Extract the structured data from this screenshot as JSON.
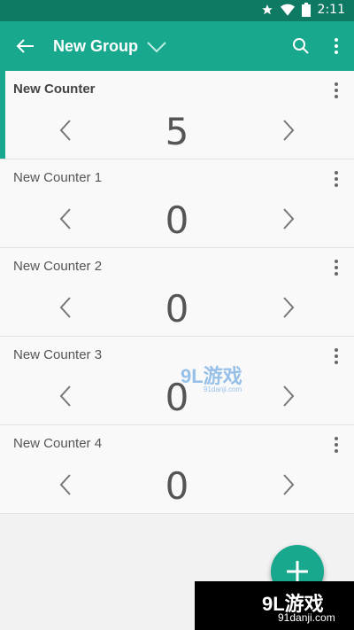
{
  "status_bar": {
    "time": "2:11"
  },
  "app_bar": {
    "title": "New Group"
  },
  "counters": [
    {
      "name": "New Counter",
      "value": "5",
      "active": true
    },
    {
      "name": "New Counter 1",
      "value": "0",
      "active": false
    },
    {
      "name": "New Counter 2",
      "value": "0",
      "active": false
    },
    {
      "name": "New Counter 3",
      "value": "0",
      "active": false
    },
    {
      "name": "New Counter 4",
      "value": "0",
      "active": false
    }
  ],
  "watermark": {
    "logo": "9L游戏",
    "site": "91danji.com",
    "center_logo": "9L游戏",
    "center_site": "91danji.com"
  },
  "colors": {
    "accent": "#17a88d",
    "status_bar": "#0f7a64"
  },
  "icons": [
    "star-icon",
    "wifi-icon",
    "battery-icon",
    "back-arrow-icon",
    "chevron-down-icon",
    "search-icon",
    "more-vert-icon",
    "chevron-left-icon",
    "chevron-right-icon",
    "plus-icon"
  ]
}
